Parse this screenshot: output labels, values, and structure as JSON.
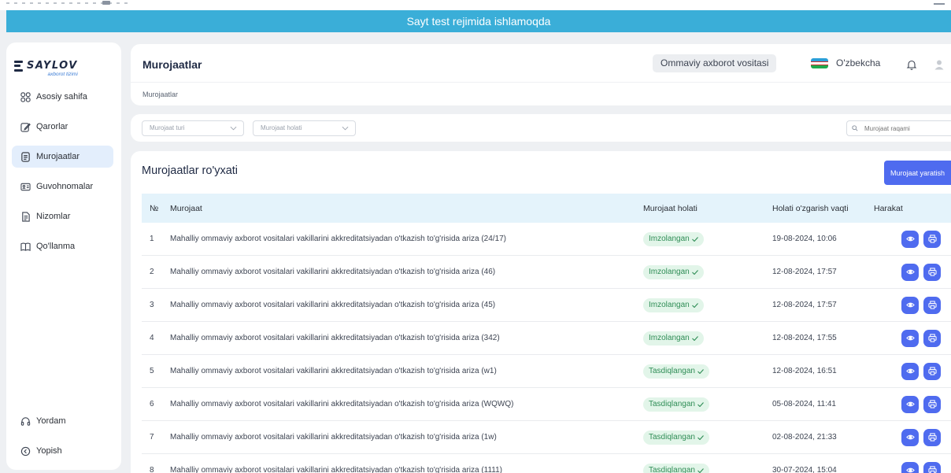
{
  "banner": {
    "text": "Sayt test rejimida ishlamoqda"
  },
  "logo": {
    "name": "SAYLOV",
    "subtitle": "axborot tizimi"
  },
  "sidebar": {
    "items": [
      {
        "label": "Asosiy sahifa",
        "icon": "grid-icon"
      },
      {
        "label": "Qarorlar",
        "icon": "edit-icon"
      },
      {
        "label": "Murojaatlar",
        "icon": "document-icon",
        "active": true
      },
      {
        "label": "Guvohnomalar",
        "icon": "id-card-icon"
      },
      {
        "label": "Nizomlar",
        "icon": "file-list-icon"
      },
      {
        "label": "Qo'llanma",
        "icon": "book-icon"
      }
    ],
    "bottom": [
      {
        "label": "Yordam",
        "icon": "headset-icon"
      },
      {
        "label": "Yopish",
        "icon": "collapse-icon"
      }
    ]
  },
  "header": {
    "title": "Murojaatlar",
    "breadcrumb": "Murojaatlar",
    "org": "Ommaviy axborot vositasi",
    "language": "O'zbekcha"
  },
  "filters": {
    "type_placeholder": "Murojaat turi",
    "status_placeholder": "Murojaat holati",
    "search_placeholder": "Murojaat raqami"
  },
  "card": {
    "title": "Murojaatlar ro'yxati",
    "create_label": "Murojaat yaratish"
  },
  "table": {
    "headers": {
      "no": "№",
      "name": "Murojaat",
      "status": "Murojaat holati",
      "time": "Holati o'zgarish vaqti",
      "action": "Harakat"
    },
    "rows": [
      {
        "no": "1",
        "name": "Mahalliy ommaviy axborot vositalari vakillarini akkreditatsiyadan o'tkazish to'g'risida ariza (24/17)",
        "status": "Imzolangan",
        "time": "19-08-2024, 10:06"
      },
      {
        "no": "2",
        "name": "Mahalliy ommaviy axborot vositalari vakillarini akkreditatsiyadan o'tkazish to'g'risida ariza (46)",
        "status": "Imzolangan",
        "time": "12-08-2024, 17:57"
      },
      {
        "no": "3",
        "name": "Mahalliy ommaviy axborot vositalari vakillarini akkreditatsiyadan o'tkazish to'g'risida ariza (45)",
        "status": "Imzolangan",
        "time": "12-08-2024, 17:57"
      },
      {
        "no": "4",
        "name": "Mahalliy ommaviy axborot vositalari vakillarini akkreditatsiyadan o'tkazish to'g'risida ariza (342)",
        "status": "Imzolangan",
        "time": "12-08-2024, 17:55"
      },
      {
        "no": "5",
        "name": "Mahalliy ommaviy axborot vositalari vakillarini akkreditatsiyadan o'tkazish to'g'risida ariza (w1)",
        "status": "Tasdiqlangan",
        "time": "12-08-2024, 16:51"
      },
      {
        "no": "6",
        "name": "Mahalliy ommaviy axborot vositalari vakillarini akkreditatsiyadan o'tkazish to'g'risida ariza (WQWQ)",
        "status": "Tasdiqlangan",
        "time": "05-08-2024, 11:41"
      },
      {
        "no": "7",
        "name": "Mahalliy ommaviy axborot vositalari vakillarini akkreditatsiyadan o'tkazish to'g'risida ariza (1w)",
        "status": "Tasdiqlangan",
        "time": "02-08-2024, 21:33"
      },
      {
        "no": "8",
        "name": "Mahalliy ommaviy axborot vositalari vakillarini akkreditatsiyadan o'tkazish to'g'risida ariza (1111)",
        "status": "Tasdiqlangan",
        "time": "30-07-2024, 15:04"
      }
    ]
  },
  "colors": {
    "banner": "#3aaed8",
    "accent": "#4f6bef",
    "status_bg": "#e2f5e9",
    "status_text": "#2f8d56",
    "table_header": "#e4f3fb",
    "active_nav": "#e3eefc"
  }
}
